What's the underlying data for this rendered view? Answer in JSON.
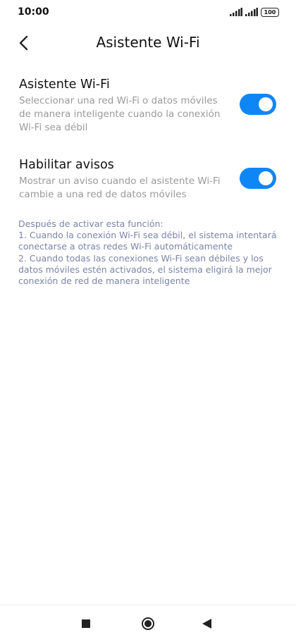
{
  "status_bar": {
    "time": "10:00",
    "battery": "100",
    "icons": [
      "signal-icon",
      "signal-icon",
      "battery-icon"
    ]
  },
  "header": {
    "back_icon": "chevron-left-icon",
    "title": "Asistente Wi-Fi"
  },
  "settings": [
    {
      "title": "Asistente Wi-Fi",
      "description": "Seleccionar una red Wi-Fi o datos móviles de manera inteligente cuando la conexión Wi-Fi sea débil",
      "enabled": true
    },
    {
      "title": "Habilitar avisos",
      "description": "Mostrar un aviso cuando el asistente Wi-Fi cambie a una red de datos móviles",
      "enabled": true
    }
  ],
  "info": {
    "heading": "Después de activar esta función:",
    "item_1": "1. Cuando la conexión Wi-Fi sea débil, el sistema intentará conectarse a otras redes Wi-Fi automáticamente",
    "item_2": "2. Cuando todas las conexiones Wi-Fi sean débiles y los datos móviles estén activados, el sistema eligirá la mejor conexión de red de manera inteligente"
  },
  "nav_bar": {
    "icons": [
      "recents-icon",
      "home-icon",
      "back-icon"
    ]
  },
  "colors": {
    "accent": "#0f86f6",
    "secondary_text": "#9a9a9a",
    "info_text": "#7c84a8"
  }
}
